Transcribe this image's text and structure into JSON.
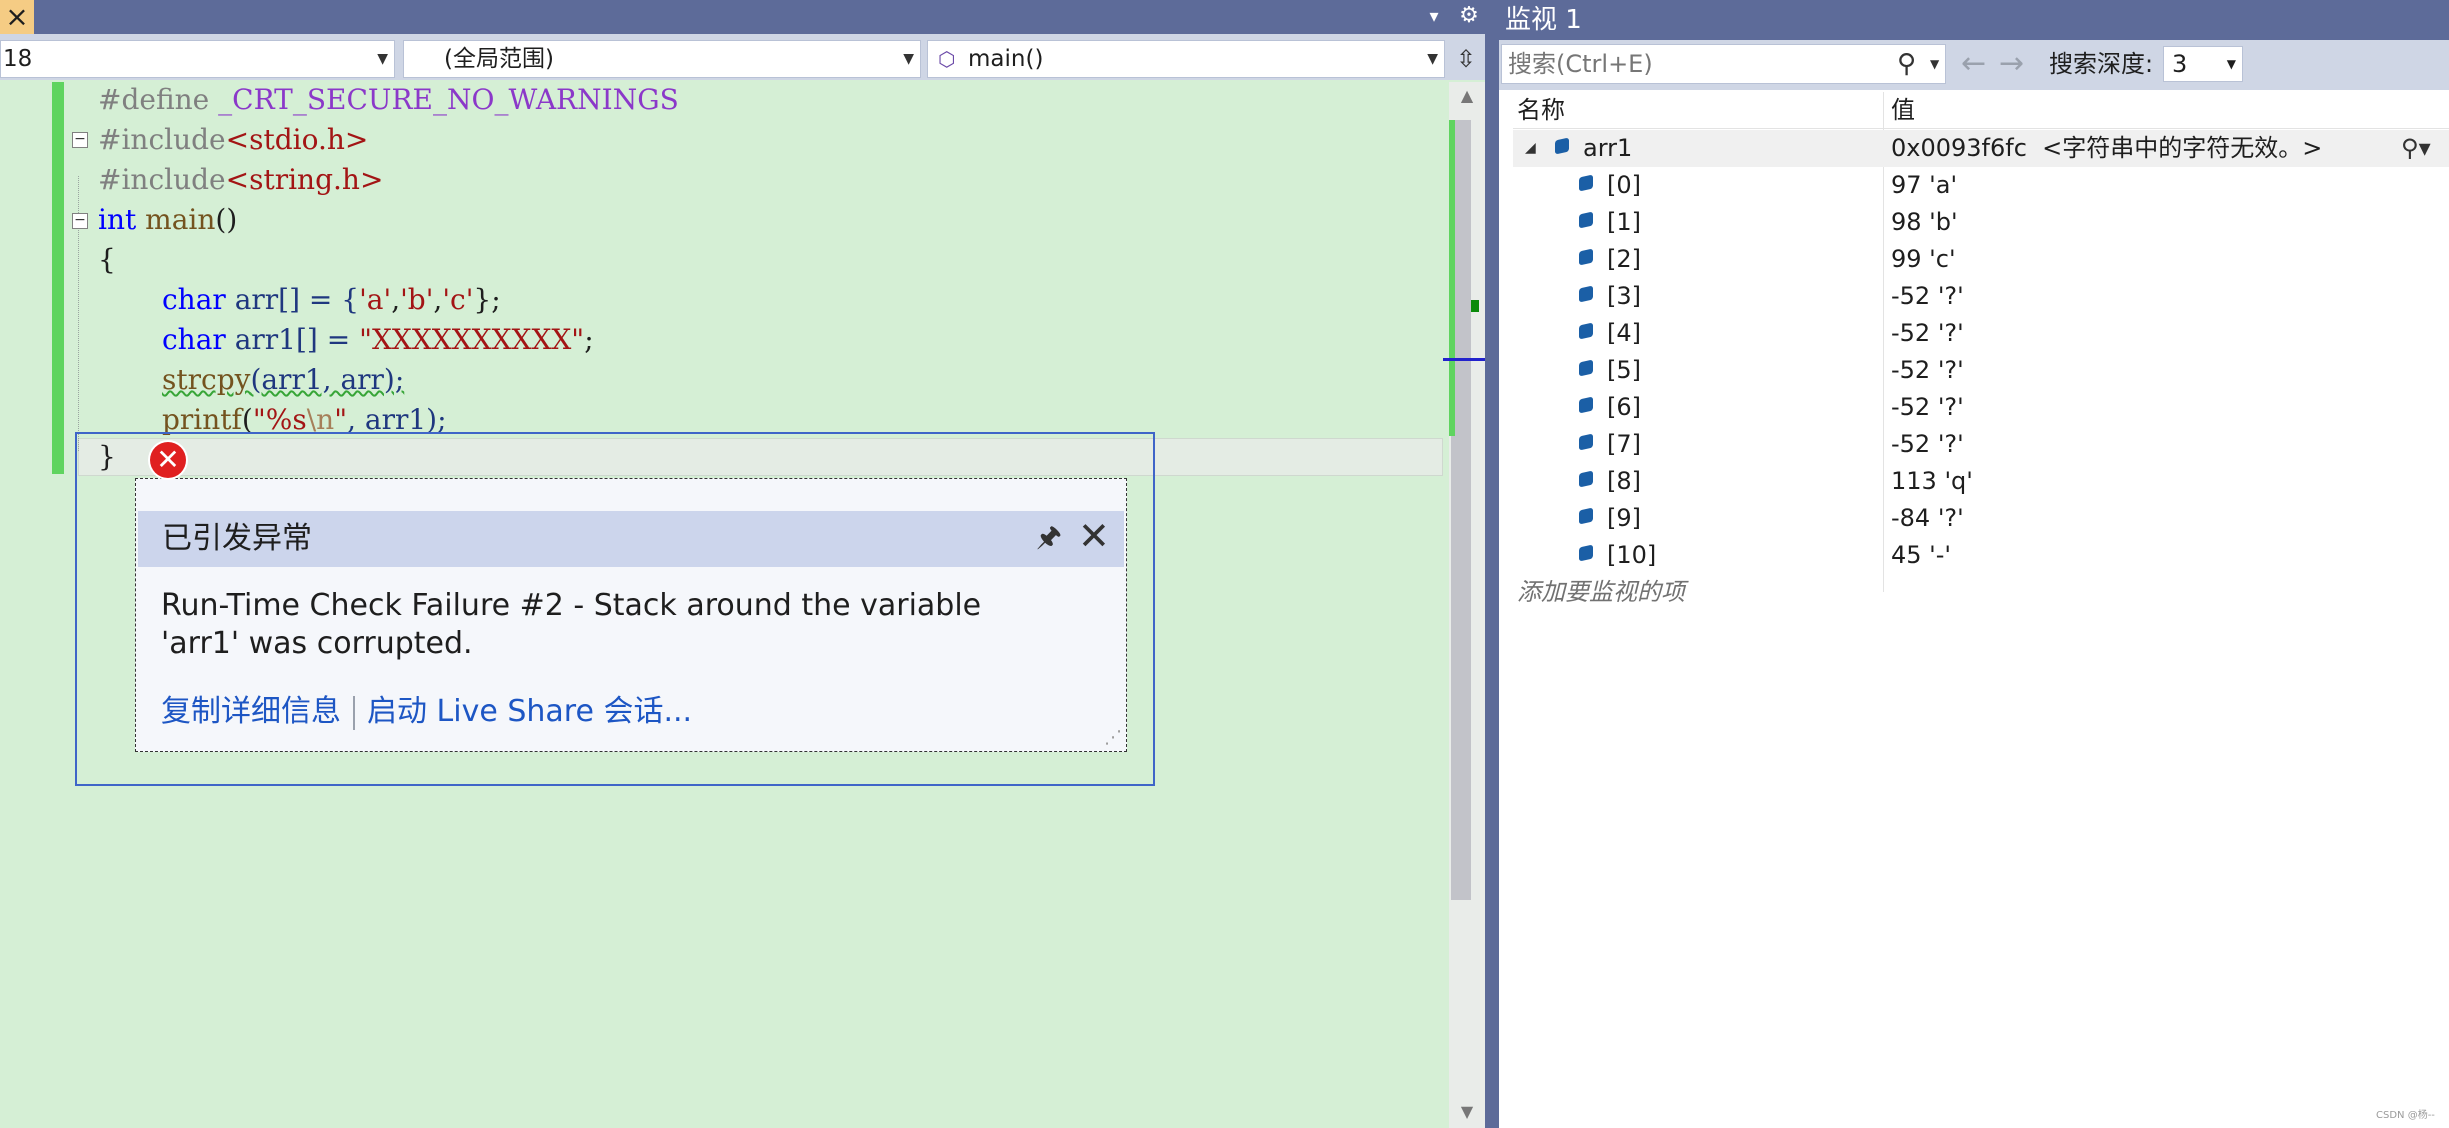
{
  "editor": {
    "close_icon": "×",
    "tab_dropdown_icon": "▾",
    "tab_gear_icon": "⚙",
    "nav": {
      "line_value": "18",
      "scope_value": "(全局范围)",
      "function_value": "main()",
      "split_icon": "⇳"
    },
    "code_lines": [
      {
        "pre": "#define ",
        "macro": "_CRT_SECURE_NO_WARNINGS"
      },
      {
        "pre": "#include",
        "hdr": "<stdio.h>"
      },
      {
        "pre": "#include",
        "hdr": "<string.h>"
      },
      {
        "kw": "int",
        "fn": " main",
        "rest": "()"
      },
      {
        "rest": "{"
      },
      {
        "kw": "char",
        "rest": " arr[] = {",
        "s1": "'a'",
        "c1": ",",
        "s2": "'b'",
        "c2": ",",
        "s3": "'c'",
        "end": "};"
      },
      {
        "kw": "char",
        "rest": " arr1[] = ",
        "str": "\"XXXXXXXXXX\"",
        "end": ";"
      },
      {
        "fn": "strcpy",
        "rest": "(arr1, arr);"
      },
      {
        "fn": "printf",
        "rest": "(",
        "str": "\"%s",
        "esc": "\\n",
        "str2": "\"",
        "end": ", arr1);"
      },
      {
        "rest": "}"
      }
    ]
  },
  "exception": {
    "title": "已引发异常",
    "message": "Run-Time Check Failure #2 - Stack around the variable 'arr1' was corrupted.",
    "copy_details_link": "复制详细信息",
    "live_share_link": "启动 Live Share 会话...",
    "error_icon": "✕",
    "pin_icon": "🖈",
    "close_icon": "✕"
  },
  "watch": {
    "title": "监视 1",
    "search_placeholder": "搜索(Ctrl+E)",
    "depth_label": "搜索深度:",
    "depth_value": "3",
    "col_name": "名称",
    "col_value": "值",
    "root": {
      "name": "arr1",
      "value": "0x0093f6fc  <字符串中的字符无效。>"
    },
    "items": [
      {
        "name": "[0]",
        "value": "97 'a'"
      },
      {
        "name": "[1]",
        "value": "98 'b'"
      },
      {
        "name": "[2]",
        "value": "99 'c'"
      },
      {
        "name": "[3]",
        "value": "-52 '?'"
      },
      {
        "name": "[4]",
        "value": "-52 '?'"
      },
      {
        "name": "[5]",
        "value": "-52 '?'"
      },
      {
        "name": "[6]",
        "value": "-52 '?'"
      },
      {
        "name": "[7]",
        "value": "-52 '?'"
      },
      {
        "name": "[8]",
        "value": "113 'q'"
      },
      {
        "name": "[9]",
        "value": "-84 '?'"
      },
      {
        "name": "[10]",
        "value": "45 '-'"
      }
    ],
    "add_watch_text": "添加要监视的项"
  },
  "watermark": "CSDN @杨--"
}
